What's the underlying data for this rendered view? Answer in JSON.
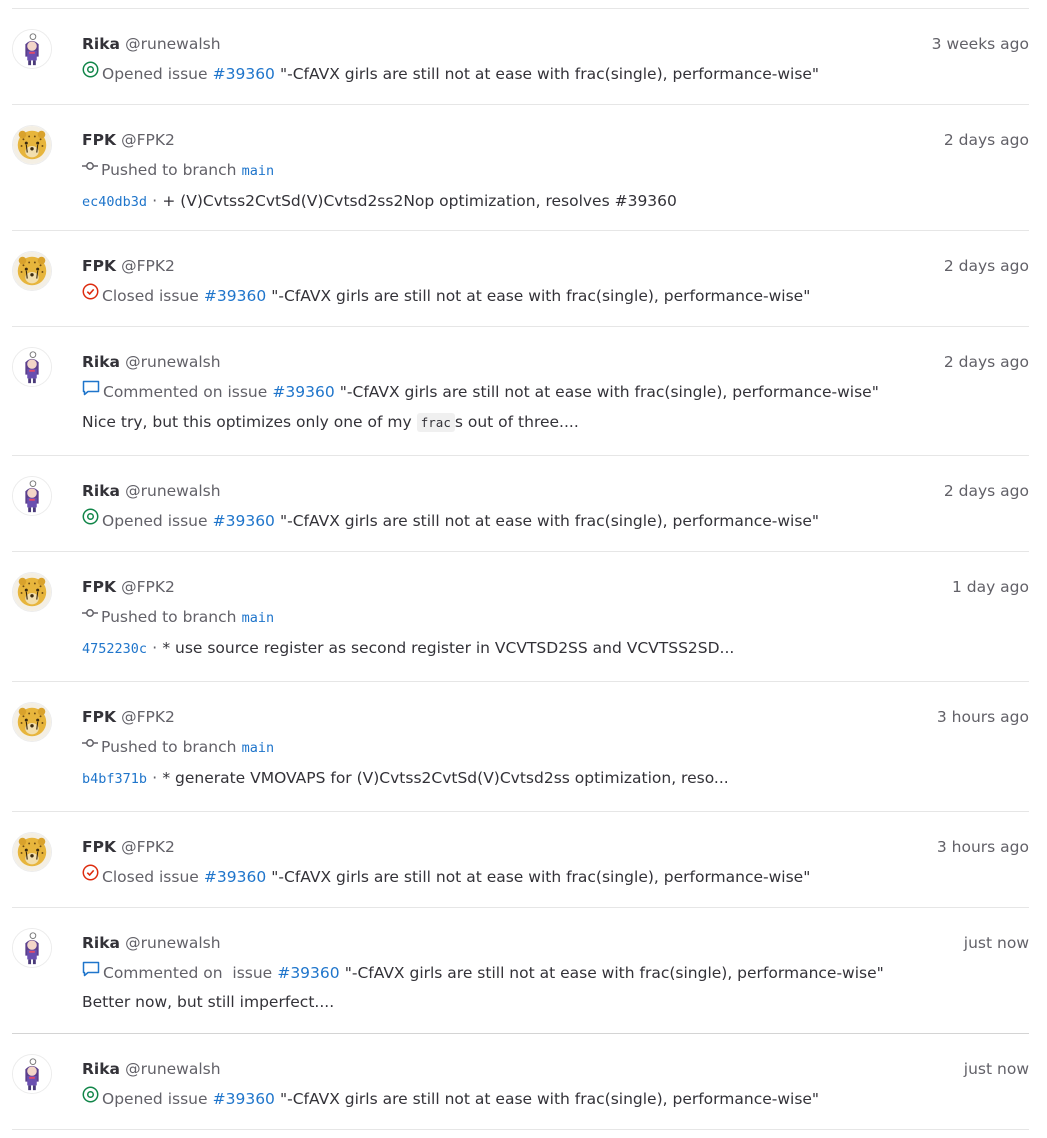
{
  "colors": {
    "link": "#1f75cb",
    "open": "#108548",
    "closed": "#dd2b0e",
    "muted": "#626168",
    "text": "#333238"
  },
  "events": [
    {
      "author": "Rika",
      "handle": "@runewalsh",
      "time": "3 weeks ago",
      "action": "Opened issue",
      "ref": "#39360",
      "title": "\"-CfAVX girls are still not at ease with frac(single), performance-wise\""
    },
    {
      "author": "FPK",
      "handle": "@FPK2",
      "time": "2 days ago",
      "action": "Pushed to branch",
      "branch": "main",
      "commit": "ec40db3d",
      "commit_sep": "·",
      "commit_msg": "+ (V)Cvtss2CvtSd(V)Cvtsd2ss2Nop optimization, resolves #39360"
    },
    {
      "author": "FPK",
      "handle": "@FPK2",
      "time": "2 days ago",
      "action": "Closed issue",
      "ref": "#39360",
      "title": "\"-CfAVX girls are still not at ease with frac(single), performance-wise\""
    },
    {
      "author": "Rika",
      "handle": "@runewalsh",
      "time": "2 days ago",
      "action": "Commented on issue",
      "ref": "#39360",
      "title": "\"-CfAVX girls are still not at ease with frac(single), performance-wise\"",
      "comment_before": "Nice try, but this optimizes only one of my",
      "comment_code": "frac",
      "comment_after": "s out of three...."
    },
    {
      "author": "Rika",
      "handle": "@runewalsh",
      "time": "2 days ago",
      "action": "Opened issue",
      "ref": "#39360",
      "title": "\"-CfAVX girls are still not at ease with frac(single), performance-wise\""
    },
    {
      "author": "FPK",
      "handle": "@FPK2",
      "time": "1 day ago",
      "action": "Pushed to branch",
      "branch": "main",
      "commit": "4752230c",
      "commit_sep": "·",
      "commit_msg": "* use source register as second register in VCVTSD2SS and VCVTSS2SD..."
    },
    {
      "author": "FPK",
      "handle": "@FPK2",
      "time": "3 hours ago",
      "action": "Pushed to branch",
      "branch": "main",
      "commit": "b4bf371b",
      "commit_sep": "·",
      "commit_msg": "* generate VMOVAPS for (V)Cvtss2CvtSd(V)Cvtsd2ss optimization, reso..."
    },
    {
      "author": "FPK",
      "handle": "@FPK2",
      "time": "3 hours ago",
      "action": "Closed issue",
      "ref": "#39360",
      "title": "\"-CfAVX girls are still not at ease with frac(single), performance-wise\""
    },
    {
      "author": "Rika",
      "handle": "@runewalsh",
      "time": "just now",
      "action": "Commented on  issue",
      "ref": "#39360",
      "title": "\"-CfAVX girls are still not at ease with frac(single), performance-wise\"",
      "comment": "Better now, but still imperfect...."
    },
    {
      "author": "Rika",
      "handle": "@runewalsh",
      "time": "just now",
      "action": "Opened issue",
      "ref": "#39360",
      "title": "\"-CfAVX girls are still not at ease with frac(single), performance-wise\""
    }
  ]
}
